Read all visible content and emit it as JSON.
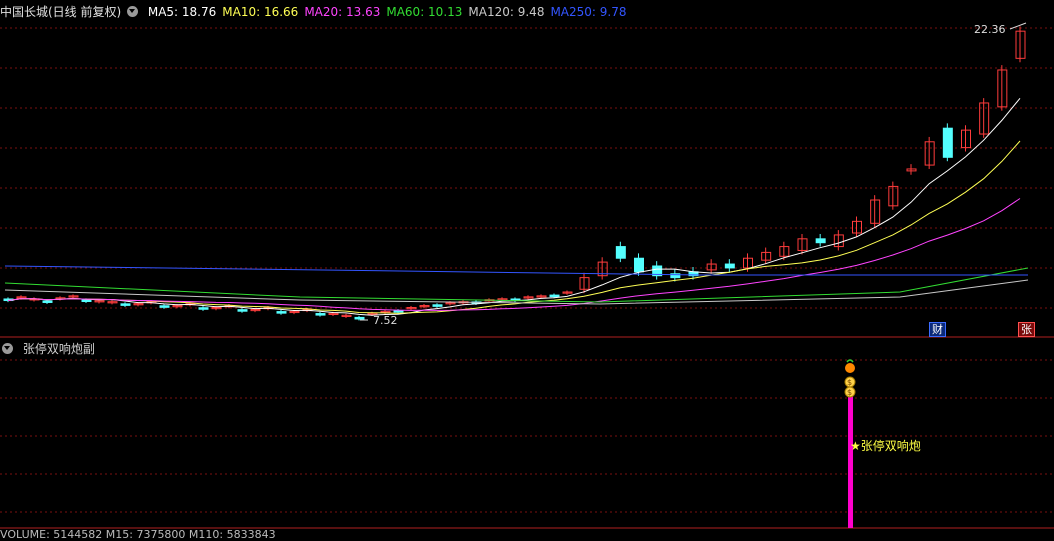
{
  "main_panel": {
    "title": "中国长城(日线 前复权)",
    "ma_labels": [
      {
        "text": "MA5: 18.76",
        "color": "#ffffff"
      },
      {
        "text": "MA10: 16.66",
        "color": "#ffff55"
      },
      {
        "text": "MA20: 13.63",
        "color": "#ff44ff"
      },
      {
        "text": "MA60: 10.13",
        "color": "#33dd33"
      },
      {
        "text": "MA120: 9.48",
        "color": "#c8c8c8"
      },
      {
        "text": "MA250: 9.78",
        "color": "#3355ff"
      }
    ],
    "high_label": "22.36",
    "low_label": "7.52",
    "badge_cai": "财",
    "badge_zhang": "张"
  },
  "sub_panel": {
    "title": "张停双响炮副",
    "signal_text": "★张停双响炮",
    "coin_glyph": "$"
  },
  "bottom_strip": {
    "text": "VOLUME: 5144582  M15: 7375800  M110: 5833843"
  },
  "colors": {
    "up": "#ff3c3c",
    "down": "#54ffff",
    "grid": "#7a1010",
    "divider": "#b02020",
    "signal_bar": "#ff00cc"
  },
  "chart_data": {
    "type": "candlestick",
    "series_note_legend": [
      "MA5",
      "MA10",
      "MA20",
      "MA60",
      "MA120",
      "MA250"
    ],
    "price_high": 22.36,
    "price_low": 7.52,
    "last_ma": {
      "MA5": 18.76,
      "MA10": 16.66,
      "MA20": 13.63,
      "MA60": 10.13,
      "MA120": 9.48,
      "MA250": 9.78
    }
  }
}
